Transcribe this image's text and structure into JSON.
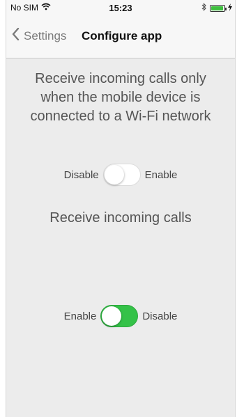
{
  "status_bar": {
    "carrier": "No SIM",
    "time": "15:23",
    "icons": [
      "wifi-icon",
      "bluetooth-icon",
      "battery-icon",
      "charging-icon"
    ]
  },
  "nav": {
    "back_label": "Settings",
    "title": "Configure app"
  },
  "wifi_only": {
    "description": "Receive incoming calls only when the mobile device is connected to a Wi-Fi network",
    "left_label": "Disable",
    "right_label": "Enable",
    "state": "Disable"
  },
  "incoming_calls": {
    "title": "Receive incoming calls",
    "left_label": "Enable",
    "right_label": "Disable",
    "state": "Enable"
  },
  "colors": {
    "toggle_on": "#34c248",
    "background": "#ececec",
    "back_link": "#7a7a7a"
  }
}
